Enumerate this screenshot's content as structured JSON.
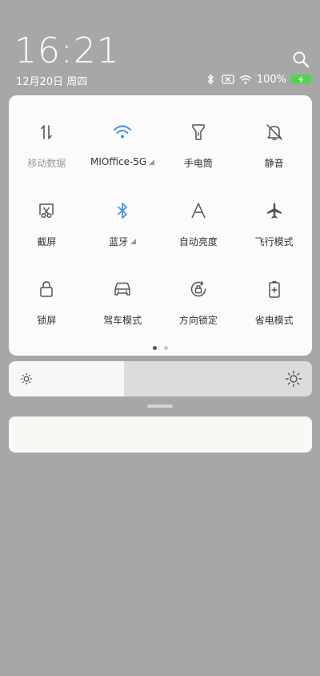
{
  "header": {
    "time": "16:21",
    "date": "12月20日 周四",
    "battery_text": "100%"
  },
  "tiles": [
    {
      "label": "移动数据",
      "icon": "mobile-data-icon",
      "state": "off"
    },
    {
      "label": "MIOffice-5G",
      "icon": "wifi-icon",
      "state": "on",
      "expandable": true
    },
    {
      "label": "手电筒",
      "icon": "flashlight-icon",
      "state": "off"
    },
    {
      "label": "静音",
      "icon": "mute-icon",
      "state": "off"
    },
    {
      "label": "截屏",
      "icon": "screenshot-icon",
      "state": "off"
    },
    {
      "label": "蓝牙",
      "icon": "bluetooth-icon",
      "state": "on",
      "expandable": true
    },
    {
      "label": "自动亮度",
      "icon": "auto-brightness-icon",
      "state": "off"
    },
    {
      "label": "飞行模式",
      "icon": "airplane-icon",
      "state": "off"
    },
    {
      "label": "锁屏",
      "icon": "lock-icon",
      "state": "off"
    },
    {
      "label": "驾车模式",
      "icon": "car-icon",
      "state": "off"
    },
    {
      "label": "方向锁定",
      "icon": "rotation-lock-icon",
      "state": "off"
    },
    {
      "label": "省电模式",
      "icon": "battery-saver-icon",
      "state": "off"
    }
  ],
  "pager": {
    "pages": 2,
    "current": 1
  },
  "brightness": {
    "level": 0.38
  },
  "colors": {
    "accent": "#3b8de8",
    "background": "#a7a7a7",
    "battery": "#50d450"
  }
}
